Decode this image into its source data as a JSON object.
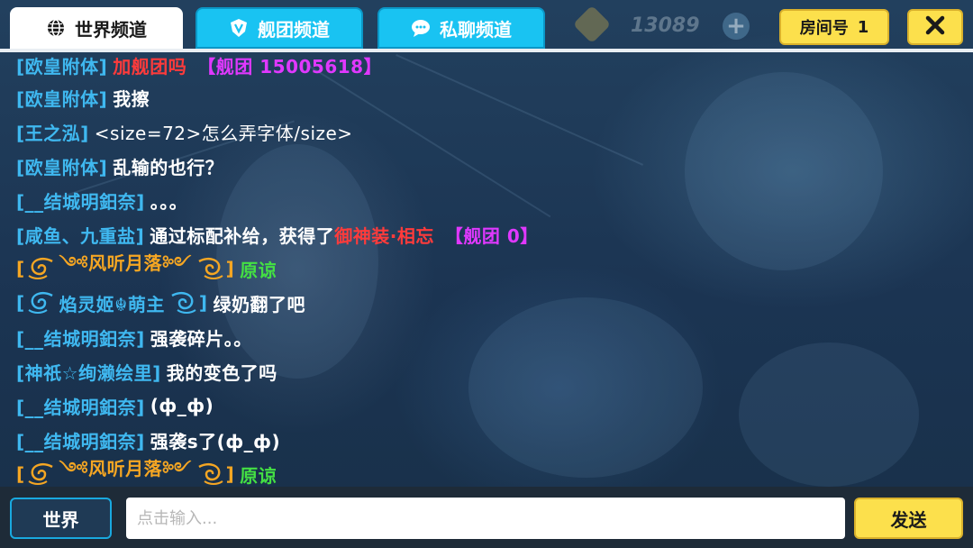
{
  "tabs": [
    {
      "label": "世界频道",
      "icon": "globe-icon"
    },
    {
      "label": "舰团频道",
      "icon": "shield-icon"
    },
    {
      "label": "私聊频道",
      "icon": "chat-bubble-icon"
    }
  ],
  "currency": {
    "value": "13089"
  },
  "room": {
    "label": "房间号",
    "number": "1"
  },
  "messages": [
    {
      "name": "[欧皇附体]",
      "text": "加舰团吗",
      "tag": "【舰团 15005618】"
    },
    {
      "name": "[欧皇附体]",
      "text": "我擦"
    },
    {
      "name": "[王之泓]",
      "text": "<size=72>怎么弄字体/size>"
    },
    {
      "name": "[欧皇附体]",
      "text": "乱输的也行？"
    },
    {
      "name": "[__结城明鈤奈]",
      "text": "。。。"
    },
    {
      "name": "[咸鱼、九重盐]",
      "text": "通过标配补给，获得了",
      "item": "御神装·相忘",
      "tag": "【舰团 0】"
    },
    {
      "name_left": "[",
      "name": "༺风听月落༻",
      "name_right": "]",
      "text": "原谅"
    },
    {
      "name_left": "[",
      "name": "焰灵姬☬萌主",
      "name_right": "]",
      "text": "绿奶翻了吧"
    },
    {
      "name": "[__结城明鈤奈]",
      "text": "强袭碎片。。"
    },
    {
      "name": "[神祇☆绚濑绘里]",
      "text": "我的变色了吗"
    },
    {
      "name": "[__结城明鈤奈]",
      "text": "(ф_ф)"
    },
    {
      "name": "[__结城明鈤奈]",
      "text": "强袭s了(ф_ф)"
    },
    {
      "name_left": "[",
      "name": "༺风听月落༻",
      "name_right": "]",
      "text": "原谅"
    }
  ],
  "bottom": {
    "channel_button": "世界",
    "input_placeholder": "点击输入...",
    "send_button": "发送"
  },
  "colors": {
    "tab_active": "#ffffff",
    "tab_inactive": "#19c3f2",
    "name_blue": "#3fb8f0",
    "name_orange": "#f5a623",
    "text_green": "#44e043",
    "text_red": "#ff3b3b",
    "tag_magenta": "#e038ff",
    "button_yellow": "#fce04c"
  }
}
